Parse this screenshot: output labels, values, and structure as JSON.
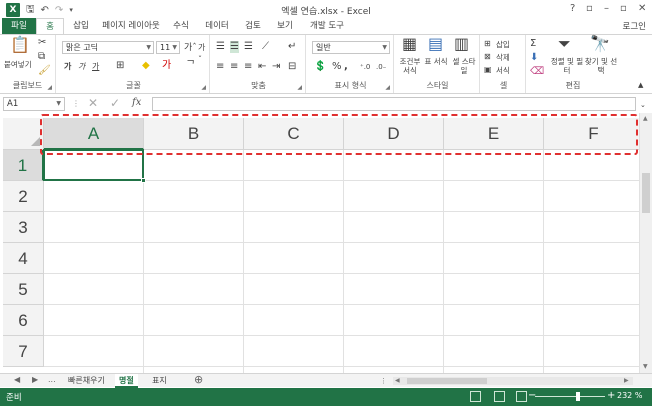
{
  "window": {
    "title": "엑셀 연습.xlsx - Excel",
    "logo_letter": "X",
    "controls": [
      "?",
      "▫",
      "–",
      "▫",
      "✕"
    ]
  },
  "tabs": [
    {
      "label": "파일",
      "kind": "file"
    },
    {
      "label": "홈",
      "kind": "active"
    },
    {
      "label": "삽입"
    },
    {
      "label": "페이지 레이아웃"
    },
    {
      "label": "수식"
    },
    {
      "label": "데이터"
    },
    {
      "label": "검토"
    },
    {
      "label": "보기"
    },
    {
      "label": "개발 도구"
    }
  ],
  "login": "로그인",
  "ribbon": {
    "clipboard": {
      "label": "클립보드",
      "paste": "붙여넣기"
    },
    "font": {
      "label": "글꼴",
      "font_name": "맑은 고딕",
      "font_size": "11",
      "bold": "가",
      "italic": "가",
      "underline": "가"
    },
    "alignment": {
      "label": "맞춤"
    },
    "number": {
      "label": "표시 형식",
      "format": "일반",
      "percent": "%",
      "comma": ","
    },
    "styles": {
      "label": "스타일",
      "cond_format": "조건부 서식",
      "table_format": "표 서식",
      "cell_style": "셀 스타일"
    },
    "cells": {
      "label": "셀",
      "insert": "삽입",
      "delete": "삭제",
      "format": "서식"
    },
    "editing": {
      "label": "편집",
      "sort_filter": "정렬 및 필터",
      "find_select": "찾기 및 선택"
    }
  },
  "formula_bar": {
    "name_box": "A1",
    "fx": "fx",
    "value": ""
  },
  "columns": [
    "A",
    "B",
    "C",
    "D",
    "E",
    "F"
  ],
  "rows": [
    "1",
    "2",
    "3",
    "4",
    "5",
    "6",
    "7"
  ],
  "selected": {
    "column": "A",
    "row": "1"
  },
  "sheets": {
    "nav": [
      "◀",
      "▶",
      "..."
    ],
    "tabs": [
      {
        "label": "빠른채우기"
      },
      {
        "label": "명절",
        "active": true
      },
      {
        "label": "표지"
      }
    ],
    "add": "⊕"
  },
  "status": {
    "ready": "준비",
    "zoom_label": "232 %",
    "zoom_fraction": 0.62
  },
  "colors": {
    "accent": "#217346",
    "annotation": "#e03030"
  }
}
